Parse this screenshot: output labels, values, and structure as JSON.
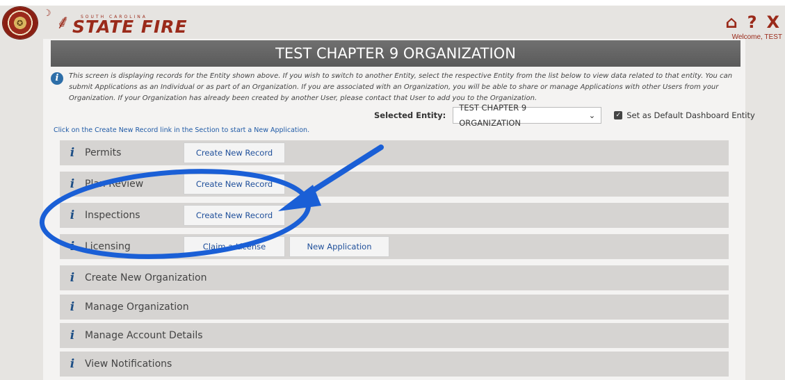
{
  "header": {
    "brand_top": "SOUTH CAROLINA",
    "brand_main": "STATE FIRE",
    "welcome": "Welcome, TEST",
    "icons": [
      "home-icon",
      "help-icon",
      "close-icon"
    ]
  },
  "page": {
    "title": "TEST CHAPTER 9 ORGANIZATION",
    "info_text": "This screen is displaying records for the Entity shown above. If you wish to switch to another Entity, select the respective Entity from the list below to view data related to that entity. You can submit Applications as an Individual or as part of an Organization. If you are associated with an Organization, you will be able to share or manage Applications with other Users from your Organization. If your Organization has already been created by another User, please contact that User to add you to the Organization.",
    "selected_entity_label": "Selected Entity:",
    "selected_entity_value": "TEST CHAPTER 9 ORGANIZATION",
    "default_checkbox_label": "Set as Default Dashboard Entity",
    "hint": "Click on the Create New Record link in the Section to start a New Application."
  },
  "sections": [
    {
      "label": "Permits",
      "buttons": [
        "Create New Record"
      ]
    },
    {
      "label": "Plan Review",
      "buttons": [
        "Create New Record"
      ]
    },
    {
      "label": "Inspections",
      "buttons": [
        "Create New Record"
      ]
    },
    {
      "label": "Licensing",
      "buttons": [
        "Claim a License",
        "New Application"
      ]
    },
    {
      "label": "Create New Organization",
      "buttons": []
    },
    {
      "label": "Manage Organization",
      "buttons": []
    },
    {
      "label": "Manage Account Details",
      "buttons": []
    },
    {
      "label": "View Notifications",
      "buttons": []
    }
  ],
  "colors": {
    "brand": "#9a2a1a",
    "annotation": "#1a5fd6",
    "link": "#1f4f9a"
  }
}
